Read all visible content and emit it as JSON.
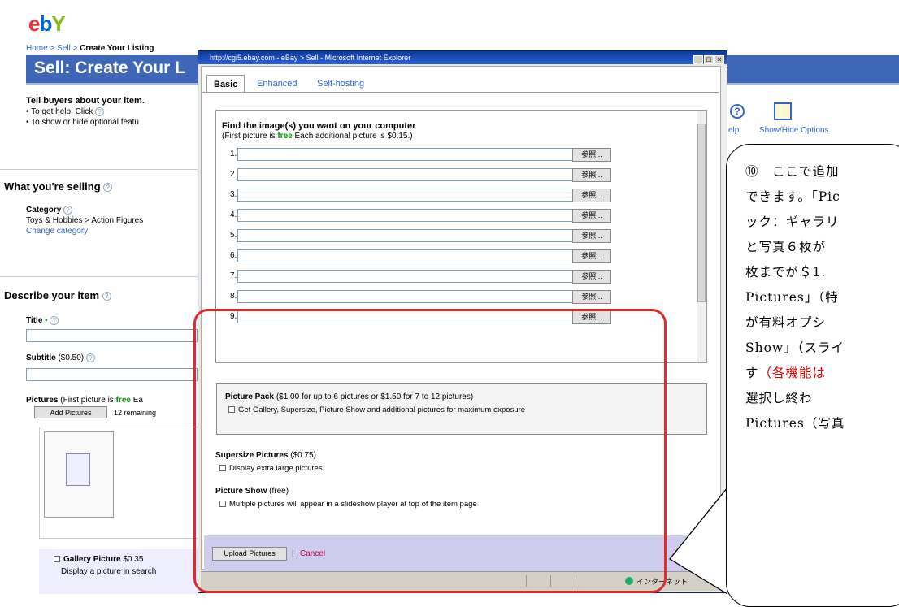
{
  "base": {
    "logo": {
      "e": "e",
      "b": "b",
      "a": "Y"
    },
    "crumbs": {
      "home": "Home",
      "sell": "Sell",
      "current": "Create Your Listing"
    },
    "header_title": "Sell: Create Your L",
    "tell": {
      "title": "Tell buyers about your item.",
      "line1": "To get help: Click",
      "line2": "To show or hide optional featu"
    },
    "help_label": "elp",
    "showhide_label": "Show/Hide Options",
    "what_selling": "What you're selling",
    "category_label": "Category",
    "category_path": "Toys & Hobbies > Action Figures",
    "change_category": "Change category",
    "describe": "Describe your item",
    "title_label": "Title",
    "subtitle_label": "Subtitle",
    "subtitle_price": "($0.50)",
    "pictures_label": "Pictures",
    "pictures_note_a": "(First picture is",
    "pictures_note_free": "free",
    "pictures_note_b": "Ea",
    "add_pictures": "Add Pictures",
    "remaining": "12 remaining",
    "gallery_label": "Gallery Picture",
    "gallery_price": "$0.35",
    "gallery_desc": "Display a picture in search"
  },
  "popup": {
    "window_title": "http://cgi5.ebay.com - eBay > Sell - Microsoft Internet Explorer",
    "window_buttons": [
      "_",
      "□",
      "×"
    ],
    "tabs": [
      {
        "label": "Basic",
        "active": true
      },
      {
        "label": "Enhanced",
        "active": false
      },
      {
        "label": "Self-hosting",
        "active": false
      }
    ],
    "find_heading": "Find the image(s) you want on your computer",
    "find_note_a": "(First picture is",
    "find_note_free": "free",
    "find_note_b": "Each additional picture is $0.15.)",
    "file_rows": [
      "1.",
      "2.",
      "3.",
      "4.",
      "5.",
      "6.",
      "7.",
      "8.",
      "9."
    ],
    "browse_label": "参照...",
    "picture_pack": {
      "title": "Picture Pack",
      "price": "($1.00 for up to 6 pictures or $1.50 for 7 to 12 pictures)",
      "option": "Get Gallery, Supersize, Picture Show and additional pictures for maximum exposure"
    },
    "supersize": {
      "title": "Supersize Pictures",
      "price": "($0.75)",
      "option": "Display extra large pictures"
    },
    "picture_show": {
      "title": "Picture Show",
      "price": "(free)",
      "option": "Multiple pictures will appear in a slideshow player at top of the item page"
    },
    "upload_button": "Upload Pictures",
    "separator": "|",
    "cancel": "Cancel",
    "status_zone": "インターネット"
  },
  "callout": {
    "lines": [
      "⑩　ここで追加",
      "できます。「Pic",
      "ック：ギャラリ",
      "と写真６枚が",
      "枚までが＄1.",
      "Pictures」（特",
      "が有料オプシ",
      "Show」（スライ",
      "す",
      "選択し終わ",
      "Pictures（写真"
    ],
    "red_fragment": "（各機能は"
  },
  "colors": {
    "header_blue": "#3e67b8",
    "highlight_red": "#e32a2a",
    "free_green": "#009900",
    "link_blue": "#3366cc",
    "upload_bar": "#cfcdee"
  }
}
